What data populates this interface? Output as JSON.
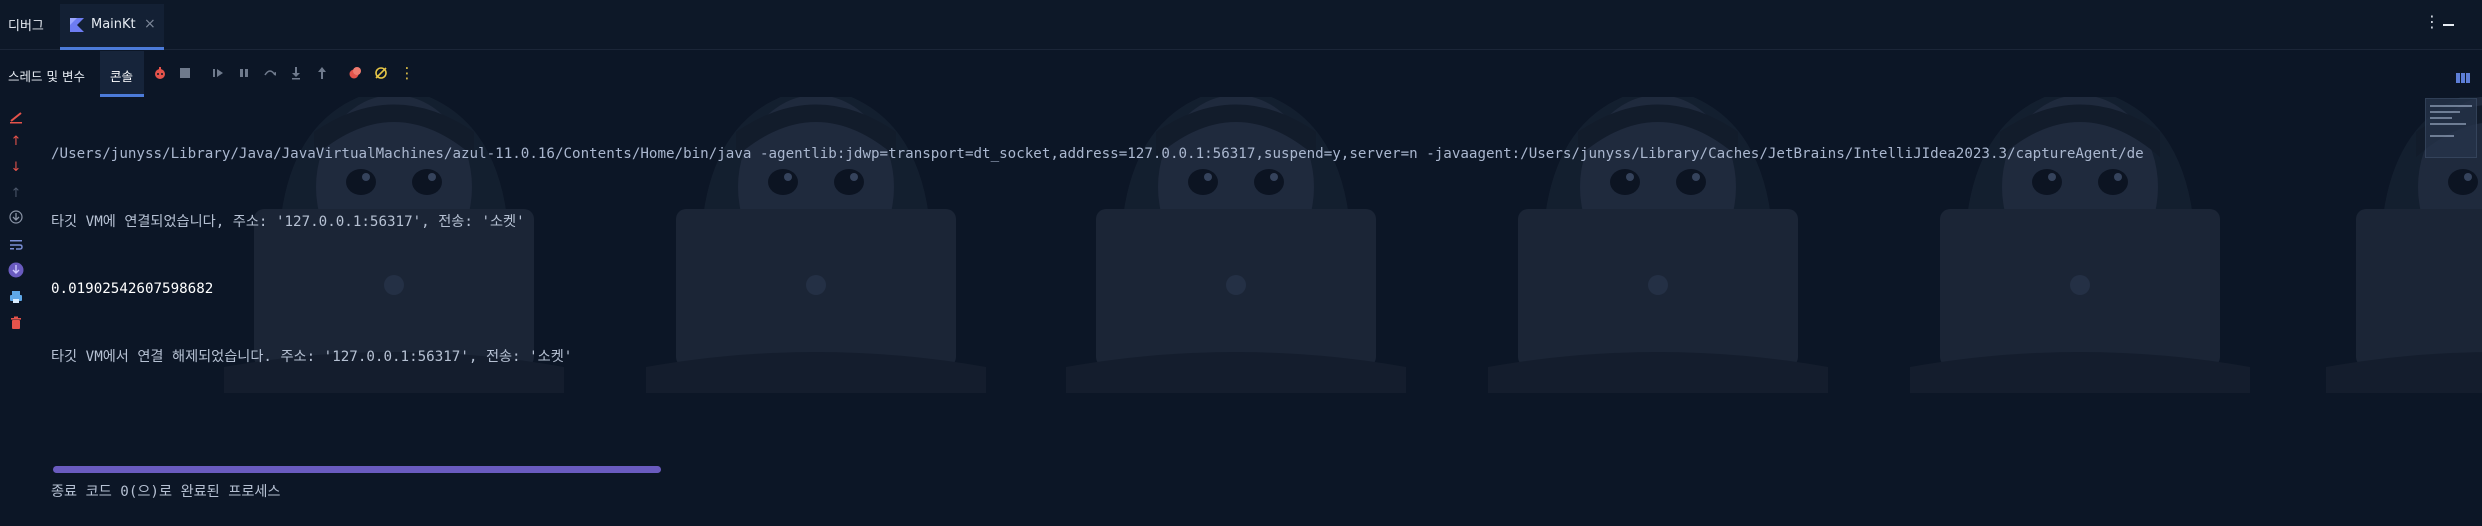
{
  "panel": {
    "title": "디버그"
  },
  "tabs": [
    {
      "label": "MainKt",
      "close": "×",
      "active": true
    }
  ],
  "toolbar": {
    "threads_label": "스레드 및 변수",
    "console_label": "콘솔",
    "icons": [
      "rerun-icon",
      "stop-icon",
      "resume-icon",
      "pause-icon",
      "step-over-icon",
      "step-into-icon",
      "step-out-icon",
      "breakpoints-icon",
      "mute-breakpoints-icon",
      "more-icon"
    ]
  },
  "gutter": {
    "icons": [
      "clear-icon",
      "up-icon",
      "down-icon",
      "up-disabled-icon",
      "scroll-to-end-icon",
      "soft-wrap-icon",
      "pin-icon",
      "print-icon",
      "trash-icon"
    ]
  },
  "console": {
    "lines": [
      {
        "kind": "cmd",
        "text": "/Users/junyss/Library/Java/JavaVirtualMachines/azul-11.0.16/Contents/Home/bin/java -agentlib:jdwp=transport=dt_socket,address=127.0.0.1:56317,suspend=y,server=n -javaagent:/Users/junyss/Library/Caches/JetBrains/IntelliJIdea2023.3/captureAgent/de"
      },
      {
        "kind": "info",
        "text": "타깃 VM에 연결되었습니다, 주소: '127.0.0.1:56317', 전송: '소켓'"
      },
      {
        "kind": "out",
        "text": "0.01902542607598682"
      },
      {
        "kind": "info",
        "text": "타깃 VM에서 연결 해제되었습니다. 주소: '127.0.0.1:56317', 전송: '소켓'"
      },
      {
        "kind": "blank",
        "text": ""
      },
      {
        "kind": "info",
        "text": "종료 코드 0(으)로 완료된 프로세스"
      }
    ]
  },
  "colors": {
    "background": "#0c1626",
    "accent": "#4c7bd9",
    "scrollbar": "#6a5bbf",
    "error_red": "#e5534b"
  }
}
